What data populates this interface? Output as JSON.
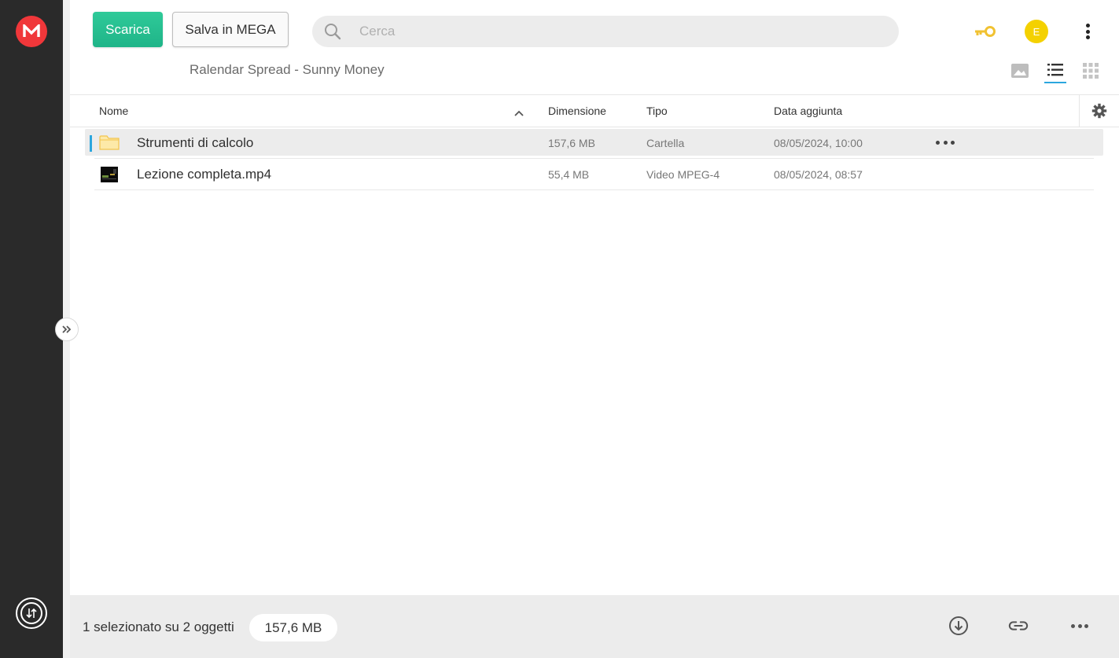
{
  "header": {
    "download_label": "Scarica",
    "save_label": "Salva in MEGA",
    "search_placeholder": "Cerca",
    "avatar_initial": "E"
  },
  "folder_title": "Ralendar Spread - Sunny Money",
  "table": {
    "columns": [
      "Nome",
      "Dimensione",
      "Tipo",
      "Data aggiunta"
    ],
    "rows": [
      {
        "name": "Strumenti di calcolo",
        "size": "157,6 MB",
        "type": "Cartella",
        "date": "08/05/2024, 10:00",
        "icon": "folder-icon",
        "selected": true
      },
      {
        "name": "Lezione completa.mp4",
        "size": "55,4 MB",
        "type": "Video MPEG-4",
        "date": "08/05/2024, 08:57",
        "icon": "video-thumbnail-icon",
        "selected": false
      }
    ]
  },
  "footer": {
    "selection_text": "1 selezionato su 2 oggetti",
    "selection_size": "157,6 MB"
  },
  "colors": {
    "accent_green": "#1fb488",
    "brand_red": "#f0373a",
    "selection_blue": "#2ba6de",
    "key_gold": "#f1c232",
    "avatar_yellow": "#f4d100"
  }
}
